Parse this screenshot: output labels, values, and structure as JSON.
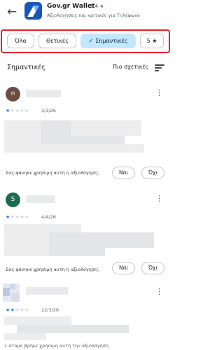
{
  "header": {
    "back_icon": "back-arrow-icon",
    "app_name": "Gov.gr Wallet",
    "rating": "3,4",
    "rating_star": "★",
    "subtitle": "Αξιολογήσεις και κριτικές για Τηλέφωνο"
  },
  "filters": {
    "chips": [
      {
        "label": "Όλα",
        "selected": false
      },
      {
        "label": "Θετικές",
        "selected": false
      },
      {
        "label": "Σημαντικές",
        "selected": true,
        "check": "✓"
      },
      {
        "label": "5",
        "star": "★",
        "selected": false
      }
    ],
    "highlight_color": "#e8202a",
    "selected_color": "#c2e7ff"
  },
  "section": {
    "title": "Σημαντικές",
    "sort_label": "Πιο σχετικές",
    "sort_icon": "sort-icon"
  },
  "reviews": [
    {
      "avatar_letter": "n",
      "avatar_color": "#6d4c41",
      "rating": 1,
      "stars_on": "★",
      "stars_off": "★★★★",
      "date": "3/3/26",
      "helpful_question": "Σας φάνηκε χρήσιμη αυτή η αξιολόγηση;",
      "yes": "Ναι",
      "no": "Όχι"
    },
    {
      "avatar_letter": "S",
      "avatar_color": "#1e6b52",
      "rating": 1,
      "stars_on": "★",
      "stars_off": "★★★★",
      "date": "4/4/26",
      "helpful_question": "Σας φάνηκε χρήσιμη αυτή η αξιολόγηση;",
      "yes": "Ναι",
      "no": "Όχι"
    },
    {
      "avatar_letter": "",
      "rating": 2,
      "stars_on": "★★",
      "stars_off": "★★★",
      "date": "22/3/26",
      "helpful_count": "1 άτομο βρήκε χρήσιμη αυτή την αξιολόγηση"
    }
  ],
  "kebab_glyph": "⋮",
  "back_glyph": "←",
  "accent": "#1a73e8"
}
